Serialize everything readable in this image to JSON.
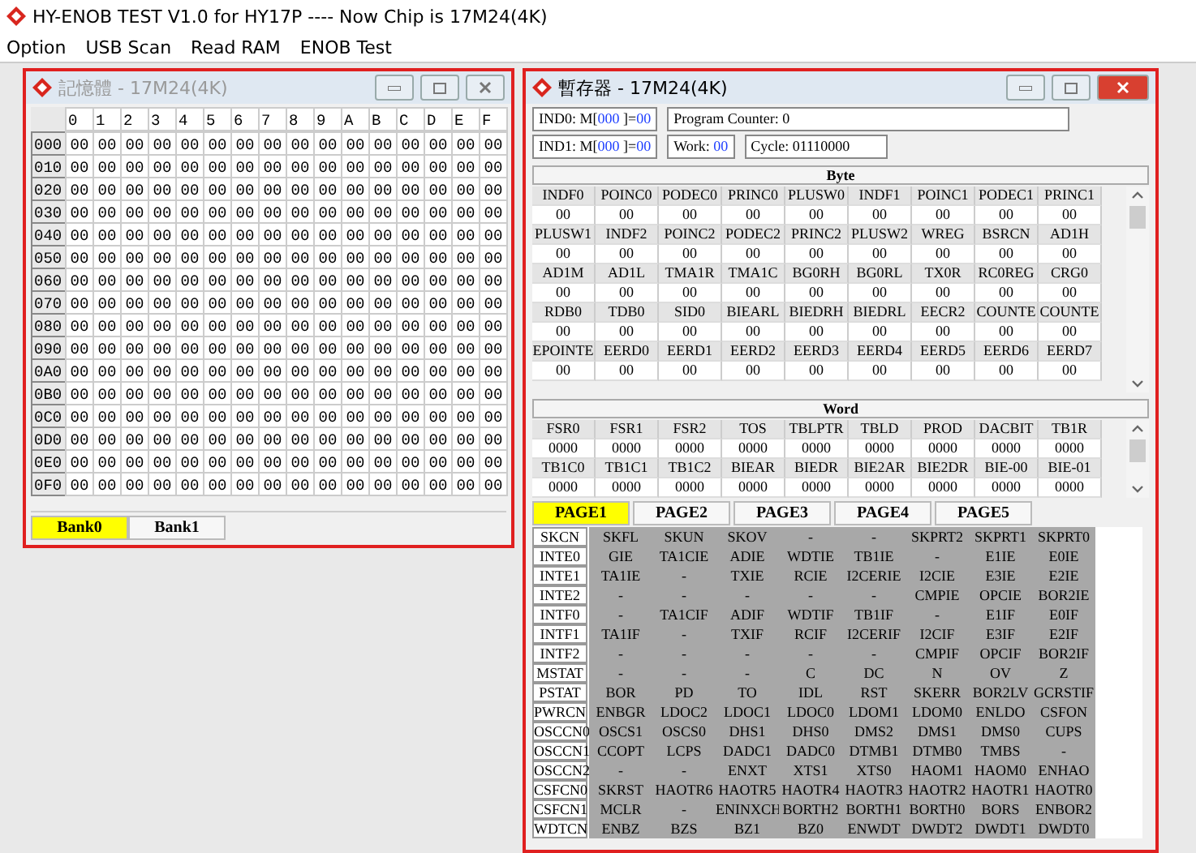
{
  "app": {
    "title": "HY-ENOB TEST V1.0 for HY17P ---- Now Chip is  17M24(4K)"
  },
  "menu": [
    "Option",
    "USB Scan",
    "Read RAM",
    "ENOB Test"
  ],
  "memory_window": {
    "title": "記憶體 - 17M24(4K)",
    "columns": [
      "0",
      "1",
      "2",
      "3",
      "4",
      "5",
      "6",
      "7",
      "8",
      "9",
      "A",
      "B",
      "C",
      "D",
      "E",
      "F"
    ],
    "rows": [
      {
        "address": "000",
        "cells": [
          "00",
          "00",
          "00",
          "00",
          "00",
          "00",
          "00",
          "00",
          "00",
          "00",
          "00",
          "00",
          "00",
          "00",
          "00",
          "00"
        ]
      },
      {
        "address": "010",
        "cells": [
          "00",
          "00",
          "00",
          "00",
          "00",
          "00",
          "00",
          "00",
          "00",
          "00",
          "00",
          "00",
          "00",
          "00",
          "00",
          "00"
        ]
      },
      {
        "address": "020",
        "cells": [
          "00",
          "00",
          "00",
          "00",
          "00",
          "00",
          "00",
          "00",
          "00",
          "00",
          "00",
          "00",
          "00",
          "00",
          "00",
          "00"
        ]
      },
      {
        "address": "030",
        "cells": [
          "00",
          "00",
          "00",
          "00",
          "00",
          "00",
          "00",
          "00",
          "00",
          "00",
          "00",
          "00",
          "00",
          "00",
          "00",
          "00"
        ]
      },
      {
        "address": "040",
        "cells": [
          "00",
          "00",
          "00",
          "00",
          "00",
          "00",
          "00",
          "00",
          "00",
          "00",
          "00",
          "00",
          "00",
          "00",
          "00",
          "00"
        ]
      },
      {
        "address": "050",
        "cells": [
          "00",
          "00",
          "00",
          "00",
          "00",
          "00",
          "00",
          "00",
          "00",
          "00",
          "00",
          "00",
          "00",
          "00",
          "00",
          "00"
        ]
      },
      {
        "address": "060",
        "cells": [
          "00",
          "00",
          "00",
          "00",
          "00",
          "00",
          "00",
          "00",
          "00",
          "00",
          "00",
          "00",
          "00",
          "00",
          "00",
          "00"
        ]
      },
      {
        "address": "070",
        "cells": [
          "00",
          "00",
          "00",
          "00",
          "00",
          "00",
          "00",
          "00",
          "00",
          "00",
          "00",
          "00",
          "00",
          "00",
          "00",
          "00"
        ]
      },
      {
        "address": "080",
        "cells": [
          "00",
          "00",
          "00",
          "00",
          "00",
          "00",
          "00",
          "00",
          "00",
          "00",
          "00",
          "00",
          "00",
          "00",
          "00",
          "00"
        ]
      },
      {
        "address": "090",
        "cells": [
          "00",
          "00",
          "00",
          "00",
          "00",
          "00",
          "00",
          "00",
          "00",
          "00",
          "00",
          "00",
          "00",
          "00",
          "00",
          "00"
        ]
      },
      {
        "address": "0A0",
        "cells": [
          "00",
          "00",
          "00",
          "00",
          "00",
          "00",
          "00",
          "00",
          "00",
          "00",
          "00",
          "00",
          "00",
          "00",
          "00",
          "00"
        ]
      },
      {
        "address": "0B0",
        "cells": [
          "00",
          "00",
          "00",
          "00",
          "00",
          "00",
          "00",
          "00",
          "00",
          "00",
          "00",
          "00",
          "00",
          "00",
          "00",
          "00"
        ]
      },
      {
        "address": "0C0",
        "cells": [
          "00",
          "00",
          "00",
          "00",
          "00",
          "00",
          "00",
          "00",
          "00",
          "00",
          "00",
          "00",
          "00",
          "00",
          "00",
          "00"
        ]
      },
      {
        "address": "0D0",
        "cells": [
          "00",
          "00",
          "00",
          "00",
          "00",
          "00",
          "00",
          "00",
          "00",
          "00",
          "00",
          "00",
          "00",
          "00",
          "00",
          "00"
        ]
      },
      {
        "address": "0E0",
        "cells": [
          "00",
          "00",
          "00",
          "00",
          "00",
          "00",
          "00",
          "00",
          "00",
          "00",
          "00",
          "00",
          "00",
          "00",
          "00",
          "00"
        ]
      },
      {
        "address": "0F0",
        "cells": [
          "00",
          "00",
          "00",
          "00",
          "00",
          "00",
          "00",
          "00",
          "00",
          "00",
          "00",
          "00",
          "00",
          "00",
          "00",
          "00"
        ]
      }
    ],
    "tabs": [
      {
        "label": "Bank0",
        "selected": true
      },
      {
        "label": "Bank1",
        "selected": false
      }
    ]
  },
  "register_window": {
    "title": "暫存器 - 17M24(4K)",
    "ind0": {
      "prefix": "IND0: M[",
      "address": "000",
      "mid": "]=",
      "value": "00"
    },
    "program_counter": "Program Counter: 0",
    "ind1": {
      "prefix": "IND1: M[",
      "address": "000",
      "mid": "]=",
      "value": "00"
    },
    "work": {
      "label": "Work:",
      "value": "00"
    },
    "cycle": "Cycle: 01110000",
    "byte": {
      "title": "Byte",
      "rows": [
        {
          "names": [
            "INDF0",
            "POINC0",
            "PODEC0",
            "PRINC0",
            "PLUSW0",
            "INDF1",
            "POINC1",
            "PODEC1",
            "PRINC1"
          ],
          "values": [
            "00",
            "00",
            "00",
            "00",
            "00",
            "00",
            "00",
            "00",
            "00"
          ]
        },
        {
          "names": [
            "PLUSW1",
            "INDF2",
            "POINC2",
            "PODEC2",
            "PRINC2",
            "PLUSW2",
            "WREG",
            "BSRCN",
            "AD1H"
          ],
          "values": [
            "00",
            "00",
            "00",
            "00",
            "00",
            "00",
            "00",
            "00",
            "00"
          ]
        },
        {
          "names": [
            "AD1M",
            "AD1L",
            "TMA1R",
            "TMA1C",
            "BG0RH",
            "BG0RL",
            "TX0R",
            "RC0REG",
            "CRG0"
          ],
          "values": [
            "00",
            "00",
            "00",
            "00",
            "00",
            "00",
            "00",
            "00",
            "00"
          ]
        },
        {
          "names": [
            "RDB0",
            "TDB0",
            "SID0",
            "BIEARL",
            "BIEDRH",
            "BIEDRL",
            "EECR2",
            "COUNTE",
            "COUNTE"
          ],
          "values": [
            "00",
            "00",
            "00",
            "00",
            "00",
            "00",
            "00",
            "00",
            "00"
          ]
        },
        {
          "names": [
            "EPOINTE",
            "EERD0",
            "EERD1",
            "EERD2",
            "EERD3",
            "EERD4",
            "EERD5",
            "EERD6",
            "EERD7"
          ],
          "values": [
            "00",
            "00",
            "00",
            "00",
            "00",
            "00",
            "00",
            "00",
            "00"
          ]
        }
      ]
    },
    "word": {
      "title": "Word",
      "rows": [
        {
          "names": [
            "FSR0",
            "FSR1",
            "FSR2",
            "TOS",
            "TBLPTR",
            "TBLD",
            "PROD",
            "DACBIT",
            "TB1R"
          ],
          "values": [
            "0000",
            "0000",
            "0000",
            "0000",
            "0000",
            "0000",
            "0000",
            "0000",
            "0000"
          ]
        },
        {
          "names": [
            "TB1C0",
            "TB1C1",
            "TB1C2",
            "BIEAR",
            "BIEDR",
            "BIE2AR",
            "BIE2DR",
            "BIE-00",
            "BIE-01"
          ],
          "values": [
            "0000",
            "0000",
            "0000",
            "0000",
            "0000",
            "0000",
            "0000",
            "0000",
            "0000"
          ]
        }
      ]
    },
    "pages": [
      {
        "label": "PAGE1",
        "selected": true
      },
      {
        "label": "PAGE2",
        "selected": false
      },
      {
        "label": "PAGE3",
        "selected": false
      },
      {
        "label": "PAGE4",
        "selected": false
      },
      {
        "label": "PAGE5",
        "selected": false
      }
    ],
    "bit_rows": [
      {
        "register": "SKCN",
        "bits": [
          "SKFL",
          "SKUN",
          "SKOV",
          "-",
          "-",
          "SKPRT2",
          "SKPRT1",
          "SKPRT0"
        ]
      },
      {
        "register": "INTE0",
        "bits": [
          "GIE",
          "TA1CIE",
          "ADIE",
          "WDTIE",
          "TB1IE",
          "-",
          "E1IE",
          "E0IE"
        ]
      },
      {
        "register": "INTE1",
        "bits": [
          "TA1IE",
          "-",
          "TXIE",
          "RCIE",
          "I2CERIE",
          "I2CIE",
          "E3IE",
          "E2IE"
        ]
      },
      {
        "register": "INTE2",
        "bits": [
          "-",
          "-",
          "-",
          "-",
          "-",
          "CMPIE",
          "OPCIE",
          "BOR2IE"
        ]
      },
      {
        "register": "INTF0",
        "bits": [
          "-",
          "TA1CIF",
          "ADIF",
          "WDTIF",
          "TB1IF",
          "-",
          "E1IF",
          "E0IF"
        ]
      },
      {
        "register": "INTF1",
        "bits": [
          "TA1IF",
          "-",
          "TXIF",
          "RCIF",
          "I2CERIF",
          "I2CIF",
          "E3IF",
          "E2IF"
        ]
      },
      {
        "register": "INTF2",
        "bits": [
          "-",
          "-",
          "-",
          "-",
          "-",
          "CMPIF",
          "OPCIF",
          "BOR2IF"
        ]
      },
      {
        "register": "MSTAT",
        "bits": [
          "-",
          "-",
          "-",
          "C",
          "DC",
          "N",
          "OV",
          "Z"
        ]
      },
      {
        "register": "PSTAT",
        "bits": [
          "BOR",
          "PD",
          "TO",
          "IDL",
          "RST",
          "SKERR",
          "BOR2LV",
          "GCRSTIF"
        ]
      },
      {
        "register": "PWRCN",
        "bits": [
          "ENBGR",
          "LDOC2",
          "LDOC1",
          "LDOC0",
          "LDOM1",
          "LDOM0",
          "ENLDO",
          "CSFON"
        ]
      },
      {
        "register": "OSCCN0",
        "bits": [
          "OSCS1",
          "OSCS0",
          "DHS1",
          "DHS0",
          "DMS2",
          "DMS1",
          "DMS0",
          "CUPS"
        ]
      },
      {
        "register": "OSCCN1",
        "bits": [
          "CCOPT",
          "LCPS",
          "DADC1",
          "DADC0",
          "DTMB1",
          "DTMB0",
          "TMBS",
          "-"
        ]
      },
      {
        "register": "OSCCN2",
        "bits": [
          "-",
          "-",
          "ENXT",
          "XTS1",
          "XTS0",
          "HAOM1",
          "HAOM0",
          "ENHAO"
        ]
      },
      {
        "register": "CSFCN0",
        "bits": [
          "SKRST",
          "HAOTR6",
          "HAOTR5",
          "HAOTR4",
          "HAOTR3",
          "HAOTR2",
          "HAOTR1",
          "HAOTR0"
        ]
      },
      {
        "register": "CSFCN1",
        "bits": [
          "MCLR",
          "-",
          "ENINXCH",
          "BORTH2",
          "BORTH1",
          "BORTH0",
          "BORS",
          "ENBOR2"
        ]
      },
      {
        "register": "WDTCN",
        "bits": [
          "ENBZ",
          "BZS",
          "BZ1",
          "BZ0",
          "ENWDT",
          "DWDT2",
          "DWDT1",
          "DWDT0"
        ]
      }
    ]
  }
}
